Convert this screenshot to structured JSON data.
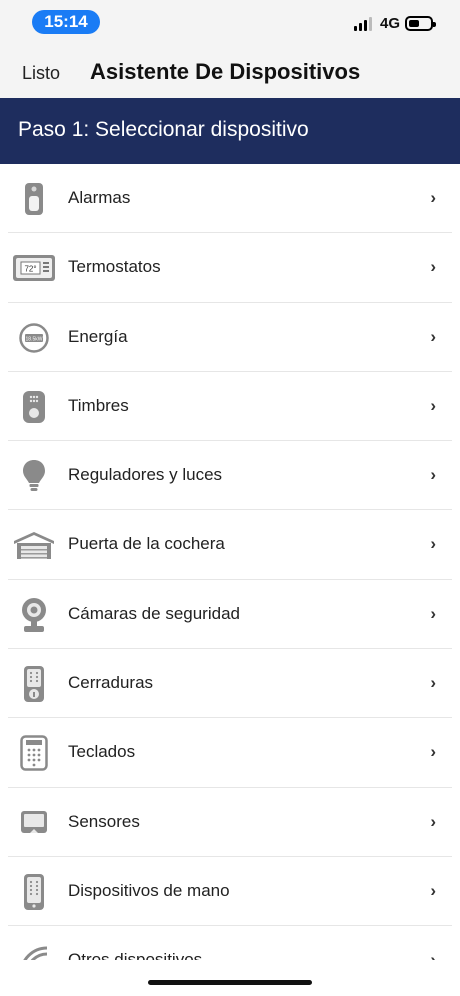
{
  "status": {
    "time": "15:14",
    "network": "4G"
  },
  "nav": {
    "done_label": "Listo",
    "title": "Asistente De Dispositivos"
  },
  "step": {
    "title": "Paso 1: Seleccionar dispositivo"
  },
  "items": [
    {
      "label": "Alarmas",
      "icon": "alarm-panel-icon"
    },
    {
      "label": "Termostatos",
      "icon": "thermostat-icon",
      "icon_text": "72°"
    },
    {
      "label": "Energía",
      "icon": "energy-meter-icon",
      "icon_text": "18.5kW"
    },
    {
      "label": "Timbres",
      "icon": "doorbell-icon"
    },
    {
      "label": "Reguladores y luces",
      "icon": "light-bulb-icon"
    },
    {
      "label": "Puerta de la cochera",
      "icon": "garage-icon"
    },
    {
      "label": "Cámaras de seguridad",
      "icon": "camera-icon"
    },
    {
      "label": "Cerraduras",
      "icon": "lock-icon"
    },
    {
      "label": "Teclados",
      "icon": "keypad-icon"
    },
    {
      "label": "Sensores",
      "icon": "sensor-icon"
    },
    {
      "label": "Dispositivos de mano",
      "icon": "handheld-remote-icon"
    },
    {
      "label": "Otros dispositivos",
      "icon": "other-devices-icon"
    }
  ],
  "chevron": "›"
}
